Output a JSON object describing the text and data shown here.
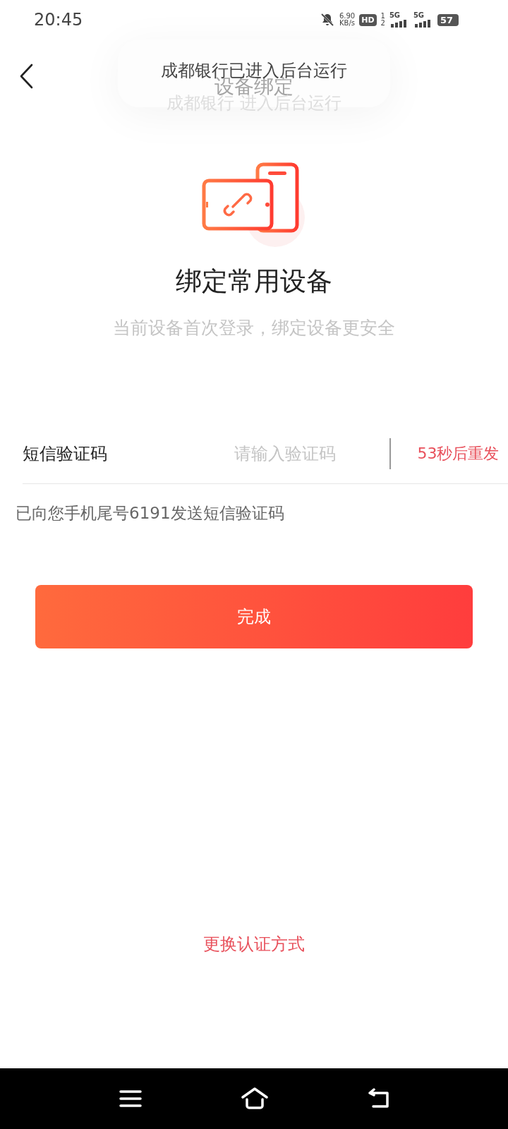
{
  "status_bar": {
    "time": "20:45",
    "speed_value": "6.90",
    "speed_unit": "KB/s",
    "hd": "HD",
    "hd_slots": [
      "1",
      "2"
    ],
    "networks": [
      "5G",
      "5G"
    ],
    "battery": "57"
  },
  "header": {
    "title": "设备绑定"
  },
  "toast": {
    "message": "成都银行已进入后台运行",
    "ghost": "成都银行 进入后台运行"
  },
  "heading": "绑定常用设备",
  "subtitle": "当前设备首次登录，绑定设备更安全",
  "sms_field": {
    "label": "短信验证码",
    "placeholder": "请输入验证码",
    "resend": "53秒后重发"
  },
  "hint": "已向您手机尾号6191发送短信验证码",
  "submit": "完成",
  "switch_method": "更换认证方式"
}
